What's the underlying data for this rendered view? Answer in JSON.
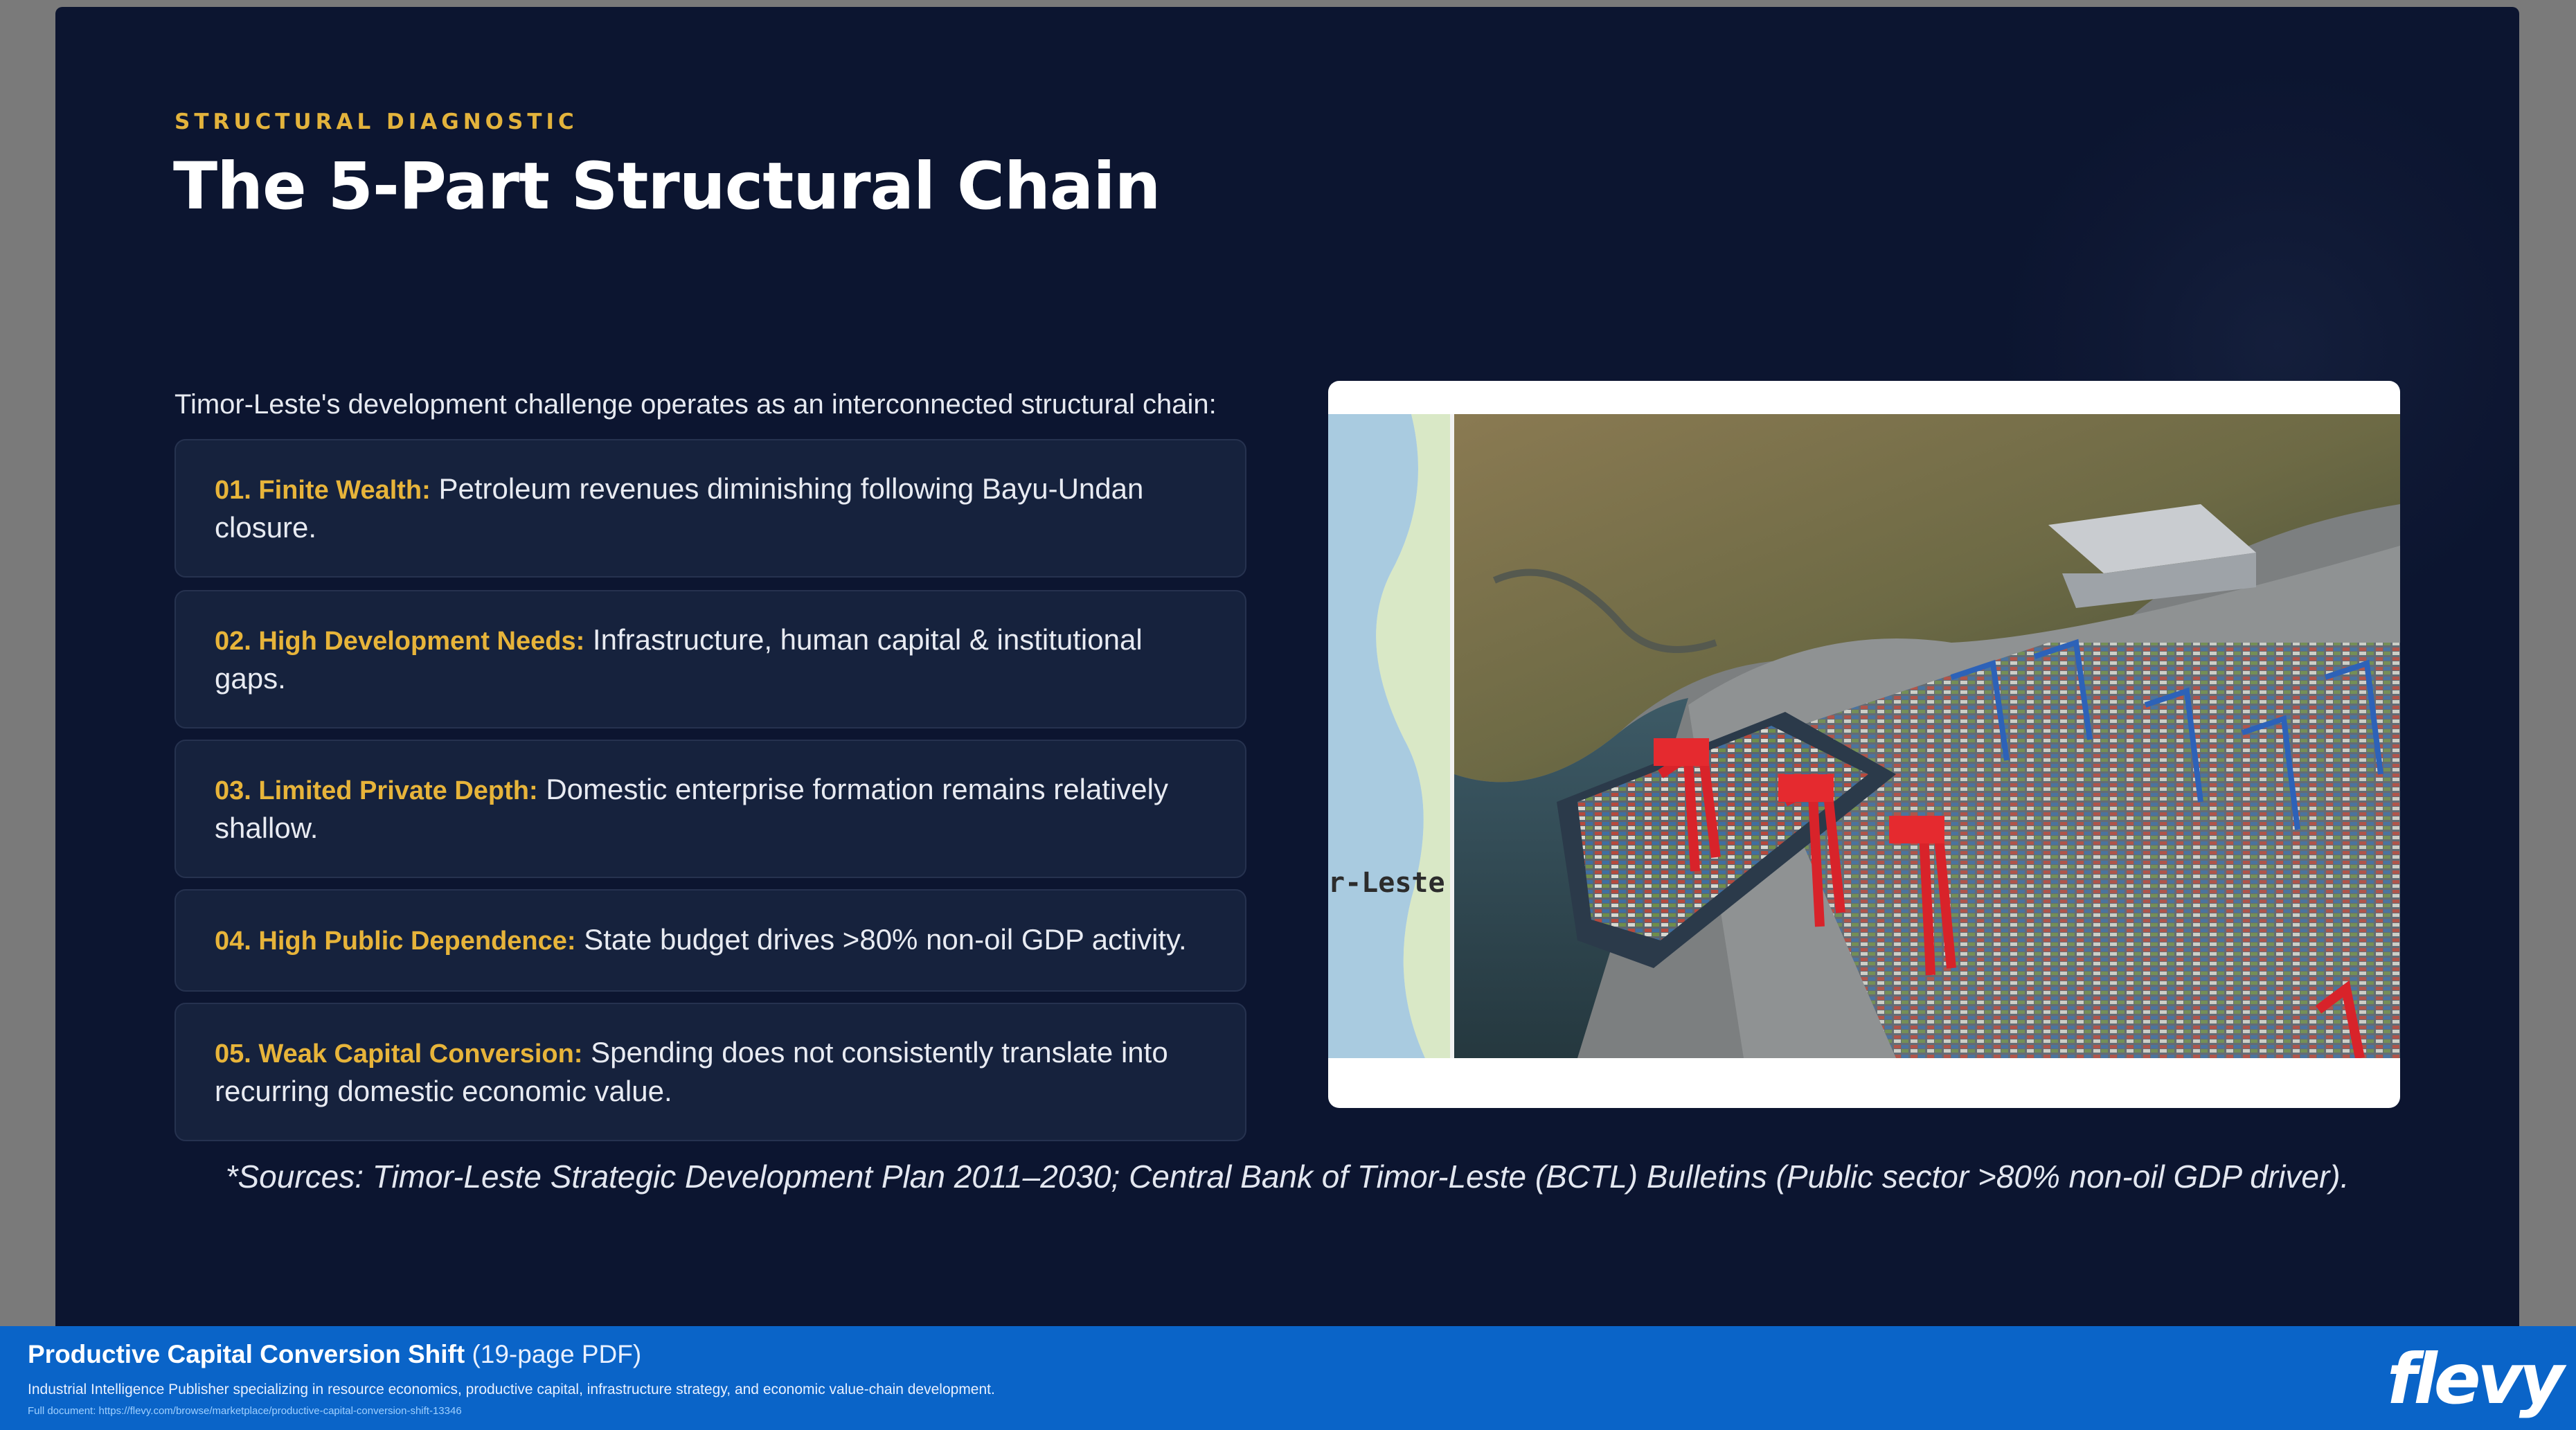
{
  "slide": {
    "kicker": "STRUCTURAL DIAGNOSTIC",
    "title": "The 5-Part Structural Chain",
    "intro": "Timor-Leste's development challenge operates as an interconnected structural chain:",
    "items": [
      {
        "label": "01. Finite Wealth:",
        "text": "Petroleum revenues diminishing following Bayu-Undan closure."
      },
      {
        "label": "02. High Development Needs:",
        "text": "Infrastructure, human capital & institutional gaps."
      },
      {
        "label": "03. Limited Private Depth:",
        "text": "Domestic enterprise formation remains relatively shallow."
      },
      {
        "label": "04. High Public Dependence:",
        "text": "State budget drives >80% non-oil GDP activity."
      },
      {
        "label": "05. Weak Capital Conversion:",
        "text": "Spending does not consistently translate into recurring domestic economic value."
      }
    ],
    "image_map_label": "r-Leste",
    "source": "*Sources: Timor-Leste Strategic Development Plan 2011–2030; Central Bank of Timor-Leste (BCTL) Bulletins (Public sector >80% non-oil GDP driver)."
  },
  "footer": {
    "title": "Productive Capital Conversion Shift",
    "pages": "(19-page PDF)",
    "description": "Industrial Intelligence Publisher specializing in resource economics, productive capital, infrastructure strategy, and economic value-chain development.",
    "link": "Full document: https://flevy.com/browse/marketplace/productive-capital-conversion-shift-13346",
    "logo": "flevy"
  }
}
